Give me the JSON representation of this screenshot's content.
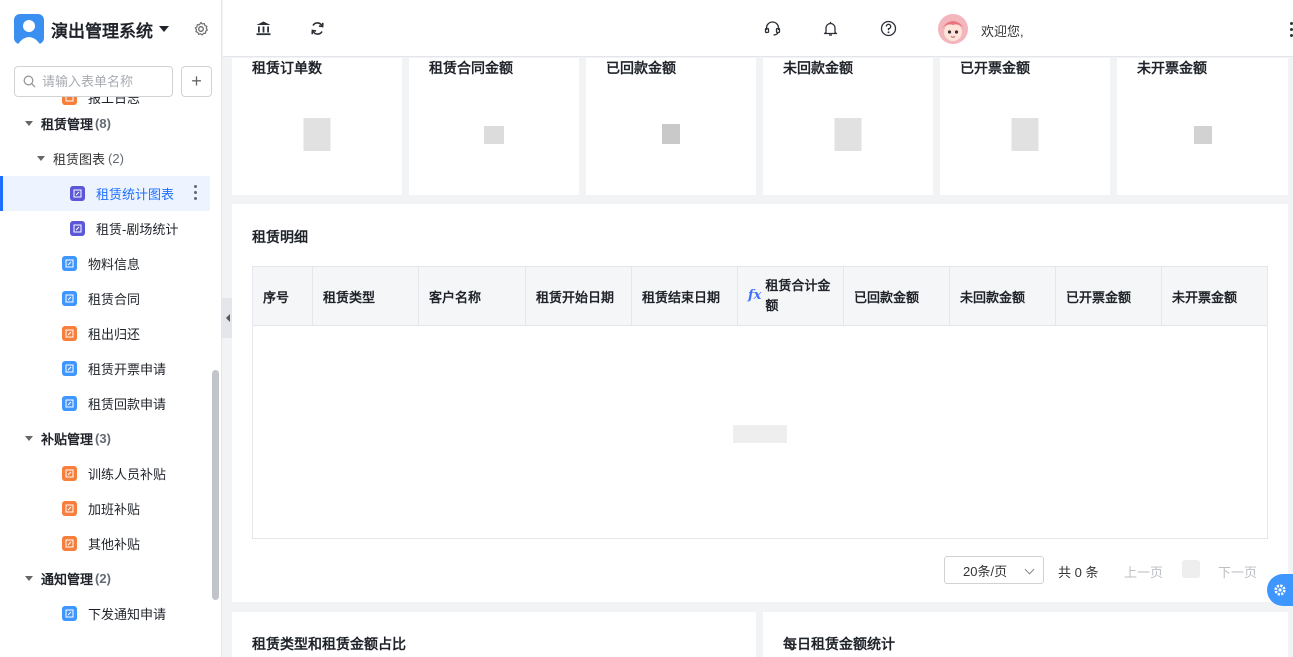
{
  "app": {
    "title": "演出管理系统"
  },
  "sidebar": {
    "search_placeholder": "请输入表单名称",
    "partial_item": "报工日志",
    "groups": [
      {
        "label": "租赁管理",
        "count": "(8)"
      },
      {
        "label": "补贴管理",
        "count": "(3)"
      },
      {
        "label": "通知管理",
        "count": "(2)"
      }
    ],
    "subgroup": {
      "label": "租赁图表",
      "count": "(2)"
    },
    "items": {
      "rent_stats_chart": "租赁统计图表",
      "rent_theater_stats": "租赁-剧场统计",
      "material_info": "物料信息",
      "rent_contract": "租赁合同",
      "rent_return": "租出归还",
      "rent_invoice": "租赁开票申请",
      "rent_payment": "租赁回款申请",
      "trainer_subsidy": "训练人员补贴",
      "overtime_subsidy": "加班补贴",
      "other_subsidy": "其他补贴",
      "notice_apply": "下发通知申请"
    }
  },
  "topbar": {
    "welcome": "欢迎您,"
  },
  "stats": [
    {
      "label": "租赁订单数"
    },
    {
      "label": "租赁合同金额"
    },
    {
      "label": "已回款金额"
    },
    {
      "label": "未回款金额"
    },
    {
      "label": "已开票金额"
    },
    {
      "label": "未开票金额"
    }
  ],
  "detail": {
    "title": "租赁明细",
    "columns": {
      "c1": "序号",
      "c2": "租赁类型",
      "c3": "客户名称",
      "c4": "租赁开始日期",
      "c5": "租赁结束日期",
      "c6": "租赁合计金额",
      "c7": "已回款金额",
      "c8": "未回款金额",
      "c9": "已开票金额",
      "c10": "未开票金额"
    },
    "fx_symbol": "fx"
  },
  "pager": {
    "page_size": "20条/页",
    "total": "共 0 条",
    "prev": "上一页",
    "next": "下一页"
  },
  "bottom": {
    "left_title": "租赁类型和租赁金额占比",
    "right_title": "每日租赁金额统计"
  },
  "colors": {
    "accent": "#1e6fff",
    "orange_icon": "#f77e3b",
    "blue_icon": "#3f96ff",
    "purple_icon": "#5b57d9"
  }
}
